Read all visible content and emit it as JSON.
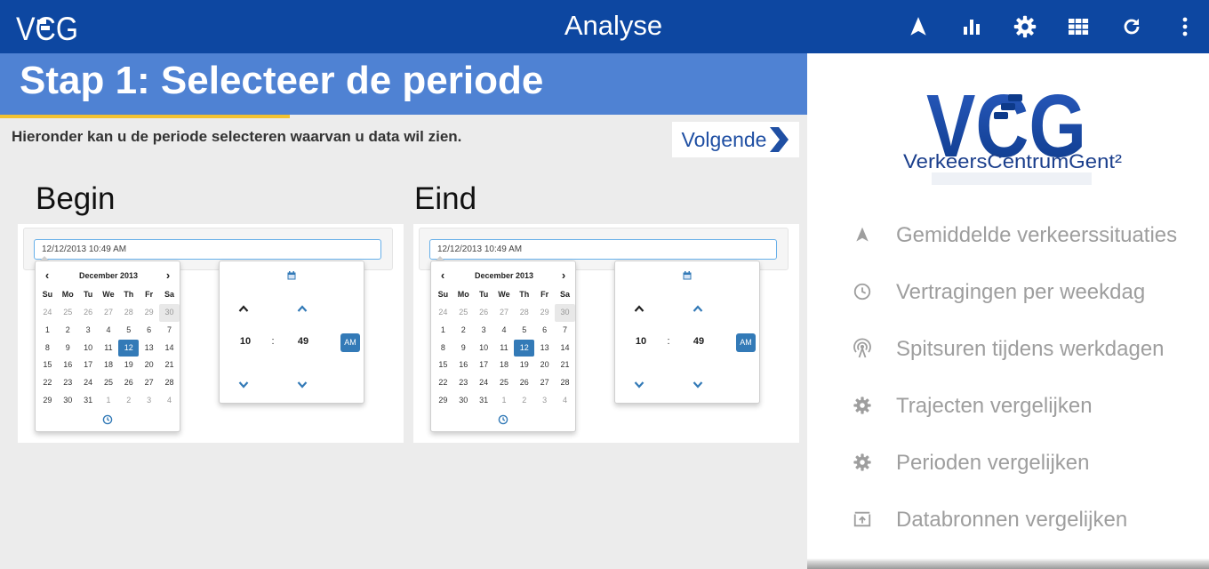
{
  "topbar": {
    "logo_text": "VCG",
    "title": "Analyse",
    "icons": [
      "navigation-icon",
      "bar-chart-icon",
      "gear-icon",
      "grid-icon",
      "refresh-icon",
      "more-vert-icon"
    ]
  },
  "main": {
    "step_title": "Stap 1: Selecteer de periode",
    "intro": "Hieronder kan u de periode selecteren waarvan u data wil zien.",
    "next_label": "Volgende",
    "begin": {
      "label": "Begin",
      "input_value": "12/12/2013 10:49 AM",
      "month_label": "December 2013",
      "hour": "10",
      "minute": "49",
      "ampm": "AM"
    },
    "end": {
      "label": "Eind",
      "input_value": "12/12/2013 10:49 AM",
      "month_label": "December 2013",
      "hour": "10",
      "minute": "49",
      "ampm": "AM"
    },
    "weekdays": [
      "Su",
      "Mo",
      "Tu",
      "We",
      "Th",
      "Fr",
      "Sa"
    ],
    "prev_symbol": "‹",
    "next_symbol": "›",
    "time_separator": ":",
    "days": [
      [
        "24",
        "25",
        "26",
        "27",
        "28",
        "29",
        "30"
      ],
      [
        "1",
        "2",
        "3",
        "4",
        "5",
        "6",
        "7"
      ],
      [
        "8",
        "9",
        "10",
        "11",
        "12",
        "13",
        "14"
      ],
      [
        "15",
        "16",
        "17",
        "18",
        "19",
        "20",
        "21"
      ],
      [
        "22",
        "23",
        "24",
        "25",
        "26",
        "27",
        "28"
      ],
      [
        "29",
        "30",
        "31",
        "1",
        "2",
        "3",
        "4"
      ]
    ],
    "selected_day": "12"
  },
  "sidebar": {
    "logo_text": "VCG",
    "logo_subtitle": "VerkeersCentrumGent²",
    "items": [
      {
        "label": "Gemiddelde verkeerssituaties",
        "icon": "navigation-icon"
      },
      {
        "label": "Vertragingen per weekdag",
        "icon": "clock-icon"
      },
      {
        "label": "Spitsuren tijdens werkdagen",
        "icon": "broadcast-icon"
      },
      {
        "label": "Trajecten vergelijken",
        "icon": "gear-icon"
      },
      {
        "label": "Perioden vergelijken",
        "icon": "gear-icon"
      },
      {
        "label": "Databronnen vergelijken",
        "icon": "upload-box-icon"
      }
    ]
  },
  "colors": {
    "topbar": "#0d47a1",
    "banner": "#4f82d3",
    "accent": "#f2c230",
    "selected": "#337ab7",
    "nav_text": "#9e9e9e"
  }
}
